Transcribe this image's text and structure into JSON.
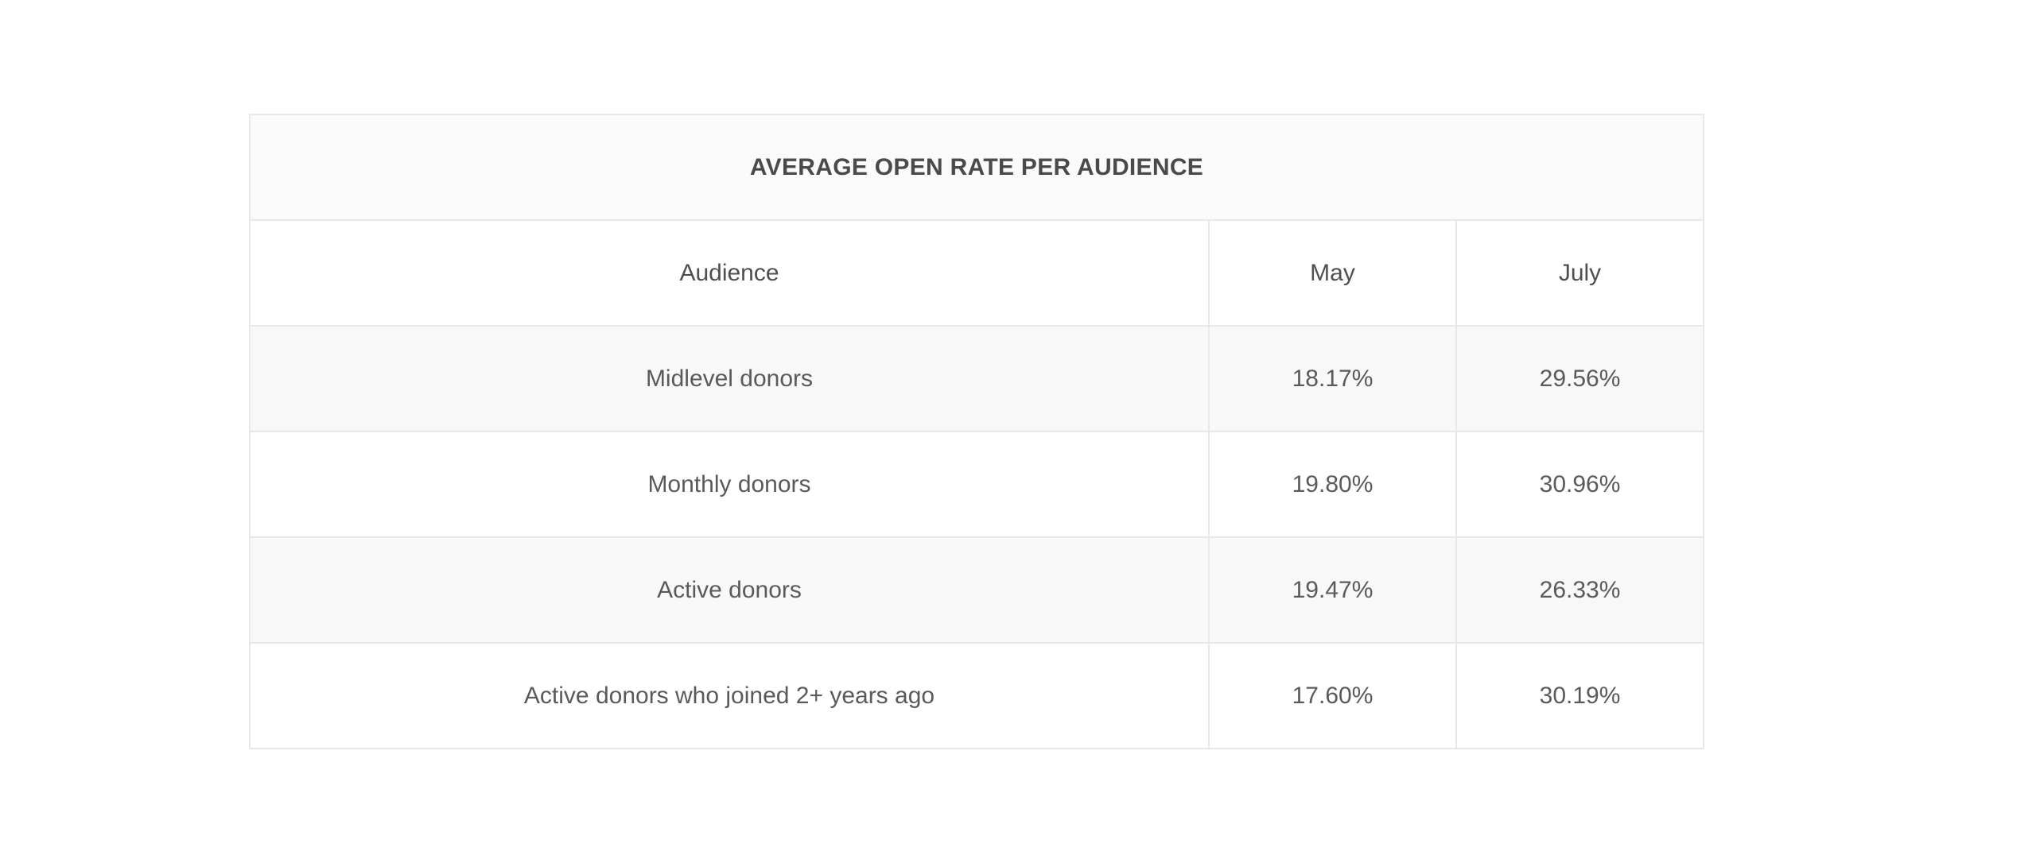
{
  "chart_data": {
    "type": "table",
    "title": "AVERAGE OPEN RATE PER AUDIENCE",
    "columns": [
      "Audience",
      "May",
      "July"
    ],
    "rows": [
      [
        "Midlevel donors",
        "18.17%",
        "29.56%"
      ],
      [
        "Monthly donors",
        "19.80%",
        "30.96%"
      ],
      [
        "Active donors",
        "19.47%",
        "26.33%"
      ],
      [
        "Active donors who joined 2+ years ago",
        "17.60%",
        "30.19%"
      ]
    ],
    "row_background_colors": [
      "#f8f8f8",
      "#ffffff",
      "#f8f8f8",
      "#ffffff"
    ],
    "border_color": "#e8e8e8"
  }
}
